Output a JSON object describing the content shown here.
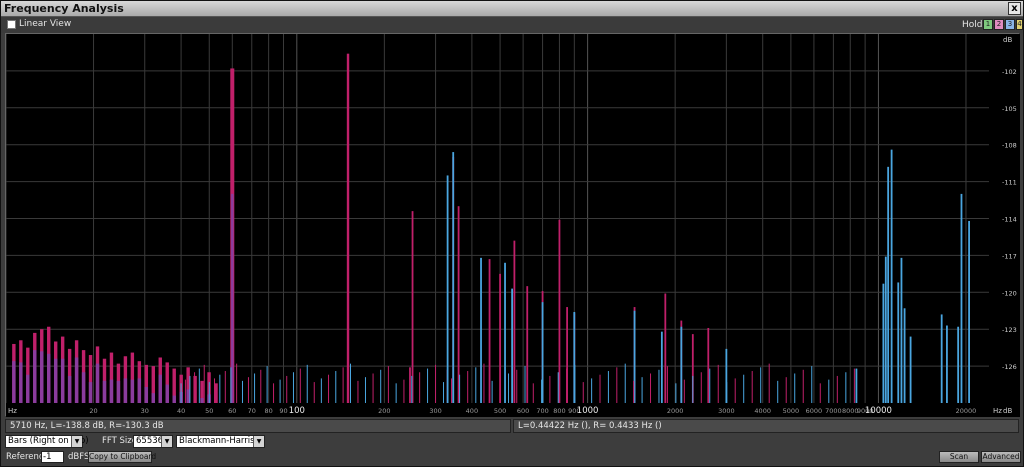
{
  "window": {
    "title": "Frequency Analysis",
    "close_label": "x"
  },
  "toolbar": {
    "linear_view_label": "Linear View",
    "hold_label": "Hold",
    "hold_buttons": [
      {
        "label": "1",
        "color": "#7ec87e"
      },
      {
        "label": "2",
        "color": "#e08ac0"
      },
      {
        "label": "3",
        "color": "#8ab4e8"
      },
      {
        "label": "4",
        "color": "#e0d070"
      }
    ]
  },
  "plot": {
    "x_unit": "Hz",
    "y_unit": "dB",
    "x_ticks": [
      "20",
      "30",
      "40",
      "50",
      "60",
      "70",
      "80",
      "90",
      "100",
      "200",
      "300",
      "400",
      "500",
      "600",
      "700",
      "800",
      "900",
      "1000",
      "2000",
      "3000",
      "4000",
      "5000",
      "6000",
      "7000",
      "8000",
      "9000",
      "10000",
      "20000"
    ],
    "y_ticks": [
      "-102",
      "-105",
      "-108",
      "-111",
      "-114",
      "-117",
      "-120",
      "-123",
      "-126"
    ],
    "colors": {
      "left": "#c0206a",
      "right": "#4aa6e0",
      "overlap": "#8a3c9e",
      "grid": "#3a3a3a"
    }
  },
  "chart_data": {
    "type": "bar",
    "title": "",
    "xlabel": "Hz",
    "ylabel": "dB",
    "x_scale": "log",
    "xlim": [
      10,
      24000
    ],
    "ylim": [
      -129,
      -99
    ],
    "series": [
      {
        "name": "L",
        "x": [
          60,
          150,
          245,
          250,
          330,
          345,
          360,
          460,
          500,
          560,
          620,
          700,
          800,
          850,
          900,
          1450,
          1850,
          2100,
          2300,
          2600
        ],
        "values": [
          -101.8,
          -100.6,
          -126.1,
          -113.4,
          -126.3,
          -109.0,
          -113.0,
          -117.3,
          -118.5,
          -115.8,
          -119.5,
          -119.9,
          -114.1,
          -121.2,
          -121.7,
          -121.2,
          -120.1,
          -122.3,
          -123.4,
          -122.9
        ]
      },
      {
        "name": "R",
        "x": [
          330,
          345,
          430,
          520,
          550,
          700,
          900,
          1450,
          1800,
          2100,
          3000,
          8400,
          10400,
          10600,
          10800,
          11100,
          11700,
          12000,
          12300,
          12900,
          16500,
          17200,
          18800,
          19300,
          20500
        ],
        "values": [
          -110.5,
          -108.6,
          -117.2,
          -117.6,
          -119.7,
          -120.8,
          -121.6,
          -121.5,
          -123.2,
          -122.8,
          -124.6,
          -126.2,
          -119.3,
          -117.1,
          -109.8,
          -108.4,
          -119.2,
          -117.2,
          -121.3,
          -123.6,
          -121.8,
          -122.7,
          -122.8,
          -112.0,
          -114.2
        ]
      }
    ]
  },
  "status": {
    "left": "5710 Hz, L=-138.8 dB, R=-130.3 dB",
    "right": "L=0.44422 Hz (), R= 0.4433 Hz ()"
  },
  "controls": {
    "display_mode": "Bars (Right on top)",
    "fft_size_label": "FFT Size",
    "fft_size": "65536",
    "window_function": "Blackmann-Harris",
    "reference_label": "Reference",
    "reference_value": "-1",
    "reference_unit": "dBFS",
    "copy_label": "Copy to Clipboard",
    "scan_label": "Scan",
    "advanced_label": "Advanced"
  }
}
